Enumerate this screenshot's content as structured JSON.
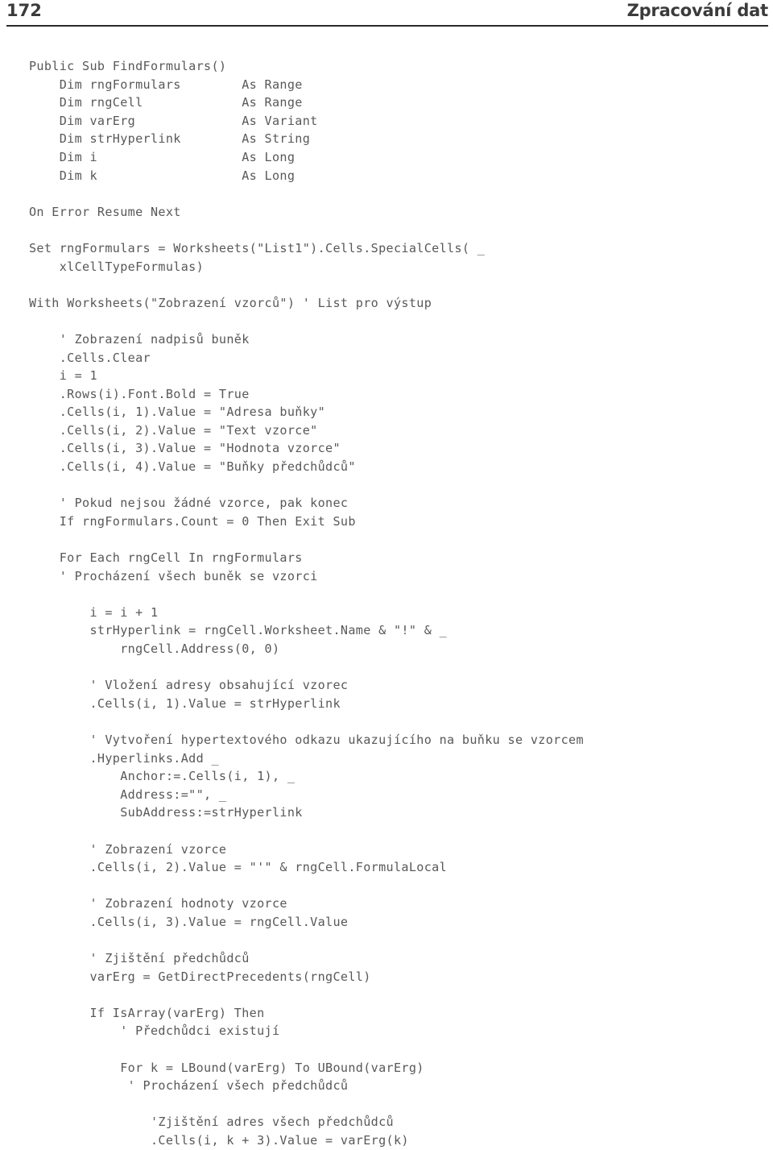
{
  "header": {
    "page_number": "172",
    "title": "Zpracování dat"
  },
  "code": {
    "language": "VBA",
    "lines": [
      "Public Sub FindFormulars()",
      "    Dim rngFormulars        As Range",
      "    Dim rngCell             As Range",
      "    Dim varErg              As Variant",
      "    Dim strHyperlink        As String",
      "    Dim i                   As Long",
      "    Dim k                   As Long",
      "",
      "On Error Resume Next",
      "",
      "Set rngFormulars = Worksheets(\"List1\").Cells.SpecialCells( _",
      "    xlCellTypeFormulas)",
      "",
      "With Worksheets(\"Zobrazení vzorců\") ' List pro výstup",
      "",
      "    ' Zobrazení nadpisů buněk",
      "    .Cells.Clear",
      "    i = 1",
      "    .Rows(i).Font.Bold = True",
      "    .Cells(i, 1).Value = \"Adresa buňky\"",
      "    .Cells(i, 2).Value = \"Text vzorce\"",
      "    .Cells(i, 3).Value = \"Hodnota vzorce\"",
      "    .Cells(i, 4).Value = \"Buňky předchůdců\"",
      "",
      "    ' Pokud nejsou žádné vzorce, pak konec",
      "    If rngFormulars.Count = 0 Then Exit Sub",
      "",
      "    For Each rngCell In rngFormulars",
      "    ' Procházení všech buněk se vzorci",
      "",
      "        i = i + 1",
      "        strHyperlink = rngCell.Worksheet.Name & \"!\" & _",
      "            rngCell.Address(0, 0)",
      "",
      "        ' Vložení adresy obsahující vzorec",
      "        .Cells(i, 1).Value = strHyperlink",
      "",
      "        ' Vytvoření hypertextového odkazu ukazujícího na buňku se vzorcem",
      "        .Hyperlinks.Add _",
      "            Anchor:=.Cells(i, 1), _",
      "            Address:=\"\", _",
      "            SubAddress:=strHyperlink",
      "",
      "        ' Zobrazení vzorce",
      "        .Cells(i, 2).Value = \"'\" & rngCell.FormulaLocal",
      "",
      "        ' Zobrazení hodnoty vzorce",
      "        .Cells(i, 3).Value = rngCell.Value",
      "",
      "        ' Zjištění předchůdců",
      "        varErg = GetDirectPrecedents(rngCell)",
      "",
      "        If IsArray(varErg) Then",
      "            ' Předchůdci existují",
      "",
      "            For k = LBound(varErg) To UBound(varErg)",
      "             ' Procházení všech předchůdců",
      "",
      "                'Zjištění adres všech předchůdců",
      "                .Cells(i, k + 3).Value = varErg(k)"
    ]
  },
  "colors": {
    "text": "#585858",
    "header_text": "#3b3b3b",
    "rule": "#2b2b2b",
    "background": "#ffffff"
  }
}
